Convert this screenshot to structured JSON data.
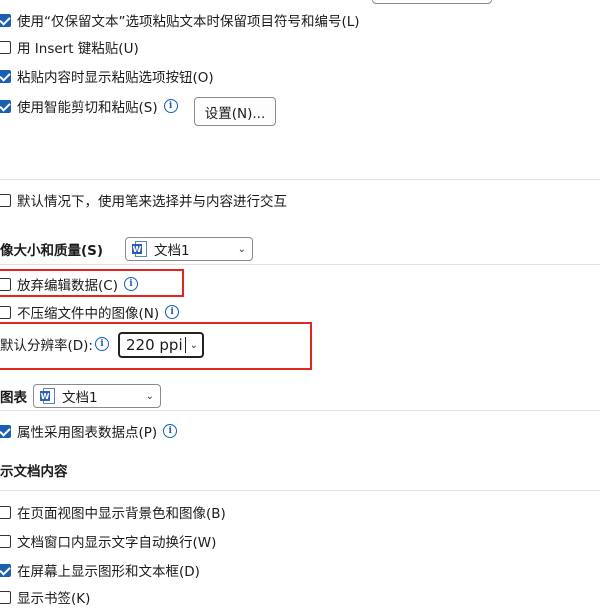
{
  "paste_options": {
    "keep_bullets": {
      "label": "使用“仅保留文本”选项粘贴文本时保留项目符号和编号(L)",
      "checked": true
    },
    "insert_key": {
      "label": "用 Insert 键粘贴(U)",
      "checked": false
    },
    "show_paste_button": {
      "label": "粘贴内容时显示粘贴选项按钮(O)",
      "checked": true
    },
    "smart_cut_paste": {
      "label": "使用智能剪切和粘贴(S)",
      "checked": true
    },
    "settings_button": "设置(N)..."
  },
  "pen": {
    "label": "默认情况下，使用笔来选择并与内容进行交互",
    "checked": false
  },
  "image_size": {
    "heading": "像大小和质量(S)",
    "document": "文档1",
    "discard_edit_data": {
      "label": "放弃编辑数据(C)",
      "checked": false
    },
    "no_compress": {
      "label": "不压缩文件中的图像(N)",
      "checked": false
    },
    "default_resolution_label": "默认分辨率(D):",
    "default_resolution_value": "220 ppi"
  },
  "chart": {
    "heading": "图表",
    "document": "文档1",
    "properties_follow": {
      "label": "属性采用图表数据点(P)",
      "checked": true
    }
  },
  "show_doc": {
    "heading": "示文档内容",
    "bg_colors": {
      "label": "在页面视图中显示背景色和图像(B)",
      "checked": false
    },
    "wrap_text": {
      "label": "文档窗口内显示文字自动换行(W)",
      "checked": false
    },
    "drawings": {
      "label": "在屏幕上显示图形和文本框(D)",
      "checked": true
    },
    "bookmarks": {
      "label": "显示书签(K)",
      "checked": false
    }
  },
  "colors": {
    "accent": "#1a5fb4",
    "highlight": "#e0261f"
  }
}
